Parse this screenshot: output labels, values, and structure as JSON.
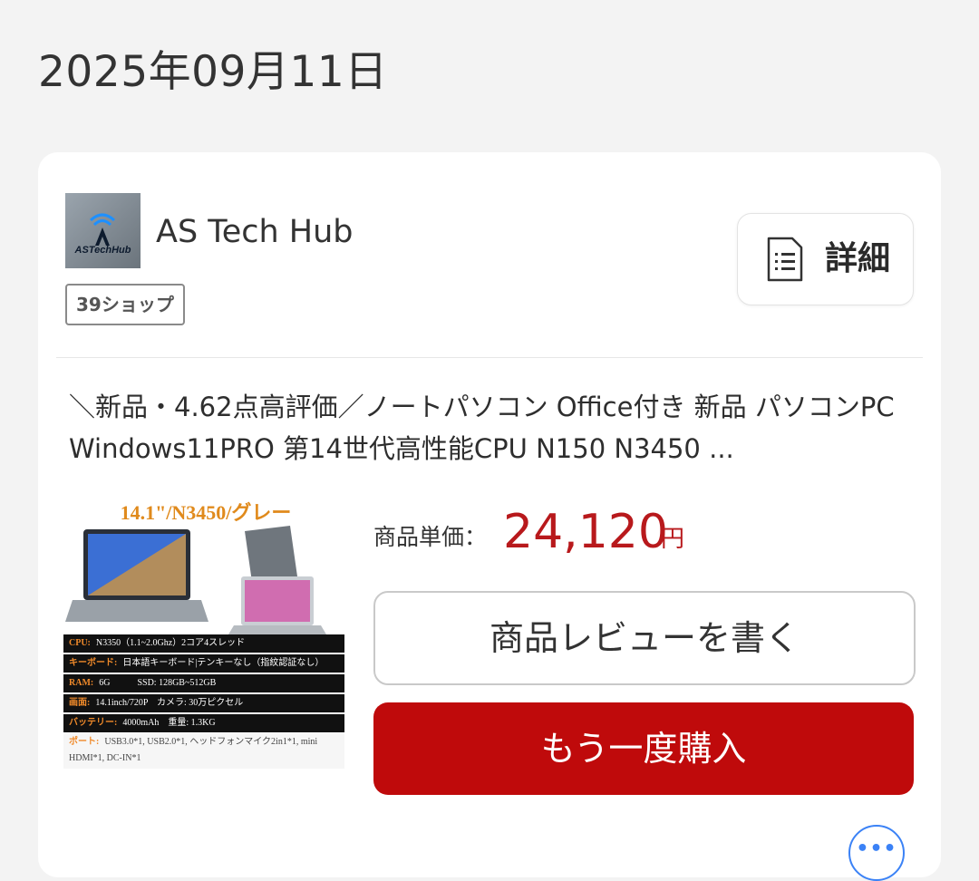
{
  "order": {
    "date": "2025年09月11日"
  },
  "shop": {
    "logo_text": "ASTechHub",
    "name": "AS Tech Hub",
    "badge": "39ショップ"
  },
  "actions": {
    "detail_label": "詳細",
    "review_label": "商品レビューを書く",
    "rebuy_label": "もう一度購入"
  },
  "product": {
    "title": "＼新品・4.62点高評価／ノートパソコン Office付き 新品 パソコンPC Windows11PRO 第14世代高性能CPU N150 N3450 ...",
    "price_label": "商品単価：",
    "price_value": "24,120",
    "price_unit": "円",
    "thumbnail": {
      "headline": "14.1\"/N3450/グレー",
      "specs": [
        {
          "k": "CPU:",
          "v": "N3350（1.1~2.0Ghz）2コア4スレッド"
        },
        {
          "k": "キーボード:",
          "v": "日本語キーボード|テンキーなし（指紋認証なし）"
        },
        {
          "k": "RAM:",
          "v": "6G　　　SSD: 128GB~512GB"
        },
        {
          "k": "画面:",
          "v": "14.1inch/720P　カメラ: 30万ピクセル"
        },
        {
          "k": "バッテリー:",
          "v": "4000mAh　重量: 1.3KG"
        },
        {
          "k": "ポート:",
          "v": "USB3.0*1, USB2.0*1, ヘッドフォンマイク2in1*1, mini HDMI*1, DC-IN*1"
        }
      ]
    }
  },
  "colors": {
    "accent_red": "#bf0a0b",
    "price_red": "#b8191c",
    "more_blue": "#3b82f6"
  }
}
